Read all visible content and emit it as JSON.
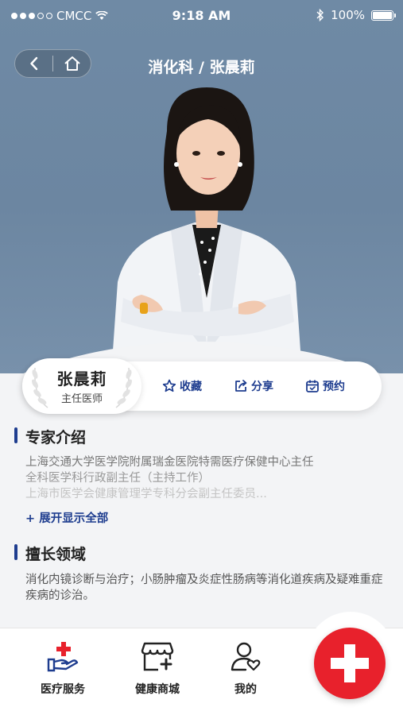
{
  "status": {
    "carrier": "CMCC",
    "time": "9:18 AM",
    "battery": "100%"
  },
  "nav": {
    "title": "消化科 / 张晨莉"
  },
  "doctor": {
    "name": "张晨莉",
    "rank": "主任医师"
  },
  "actions": [
    {
      "label": "收藏",
      "icon": "star-icon"
    },
    {
      "label": "分享",
      "icon": "share-icon"
    },
    {
      "label": "预约",
      "icon": "calendar-icon"
    }
  ],
  "intro": {
    "heading": "专家介绍",
    "lines": [
      "上海交通大学医学院附属瑞金医院特需医疗保健中心主任",
      "全科医学科行政副主任（主持工作）",
      "上海市医学会健康管理学专科分会副主任委员..."
    ],
    "expand_label": "+ 展开显示全部"
  },
  "specialty": {
    "heading": "擅长领域",
    "text": "消化内镜诊断与治疗；小肠肿瘤及炎症性肠病等消化道疾病及疑难重症疾病的诊治。"
  },
  "tabs": [
    {
      "label": "医疗服务",
      "icon": "medical-service-icon"
    },
    {
      "label": "健康商城",
      "icon": "health-store-icon"
    },
    {
      "label": "我的",
      "icon": "user-icon"
    }
  ],
  "colors": {
    "accent": "#1e3d8f",
    "hero_bg": "#6f8aa5",
    "fab": "#e8212c"
  }
}
